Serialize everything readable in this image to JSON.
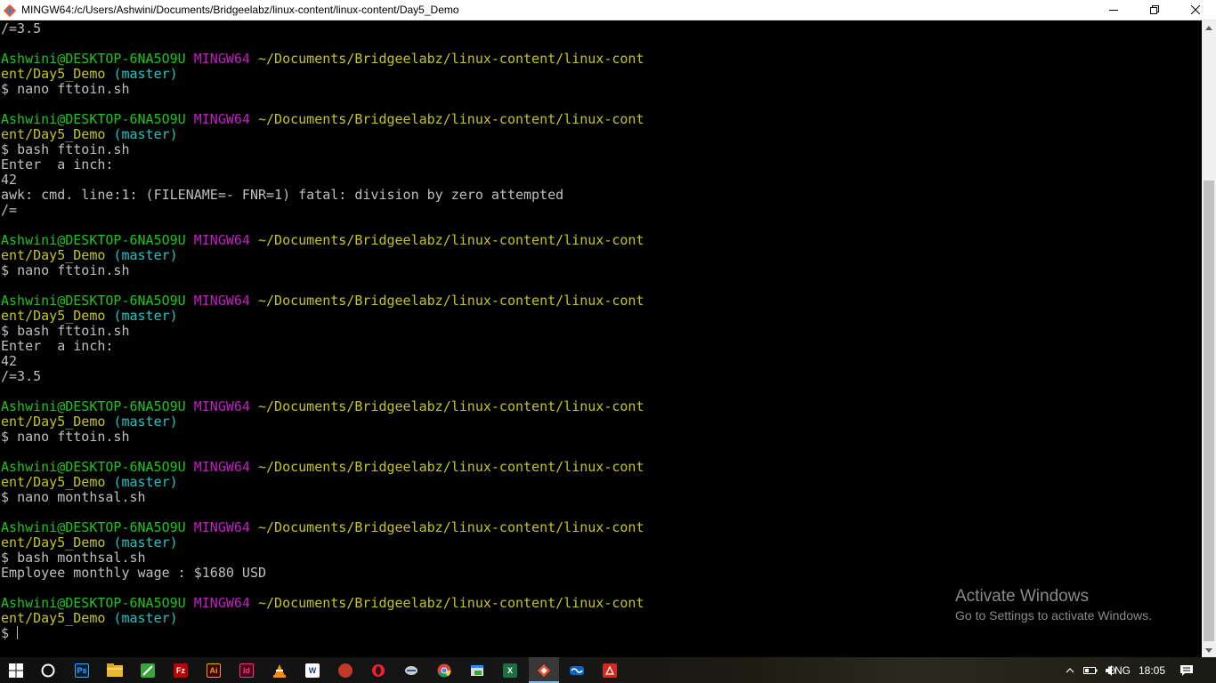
{
  "window": {
    "title": "MINGW64:/c/Users/Ashwini/Documents/Bridgeelabz/linux-content/linux-content/Day5_Demo"
  },
  "terminal": {
    "prompt": {
      "user": "Ashwini@DESKTOP-6NA5O9U",
      "system": "MINGW64",
      "path_line1": "~/Documents/Bridgeelabz/linux-content/linux-cont",
      "path_line2": "ent/Day5_Demo",
      "branch": "(master)",
      "symbol": "$"
    },
    "lines": {
      "l0": "/=3.5",
      "c1": "nano fttoin.sh",
      "c2": "bash fttoin.sh",
      "o2a": "Enter  a inch:",
      "o2b": "42",
      "o2c": "awk: cmd. line:1: (FILENAME=- FNR=1) fatal: division by zero attempted",
      "o2d": "/=",
      "c3": "nano fttoin.sh",
      "c4": "bash fttoin.sh",
      "o4a": "Enter  a inch:",
      "o4b": "42",
      "o4c": "/=3.5",
      "c5": "nano fttoin.sh",
      "c6": "nano monthsal.sh",
      "c7": "bash monthsal.sh",
      "o7a": "Employee monthly wage : $1680 USD"
    }
  },
  "watermark": {
    "title": "Activate Windows",
    "subtitle": "Go to Settings to activate Windows."
  },
  "taskbar": {
    "language": "ENG",
    "time": "18:05",
    "icons": {
      "photoshop": "Ps",
      "illustrator": "Ai",
      "indesign": "Id"
    }
  },
  "colors": {
    "user": "#1cc41c",
    "system": "#c41cc4",
    "path": "#c4c41c",
    "branch": "#1cc4c4",
    "text": "#bfbfbf"
  }
}
